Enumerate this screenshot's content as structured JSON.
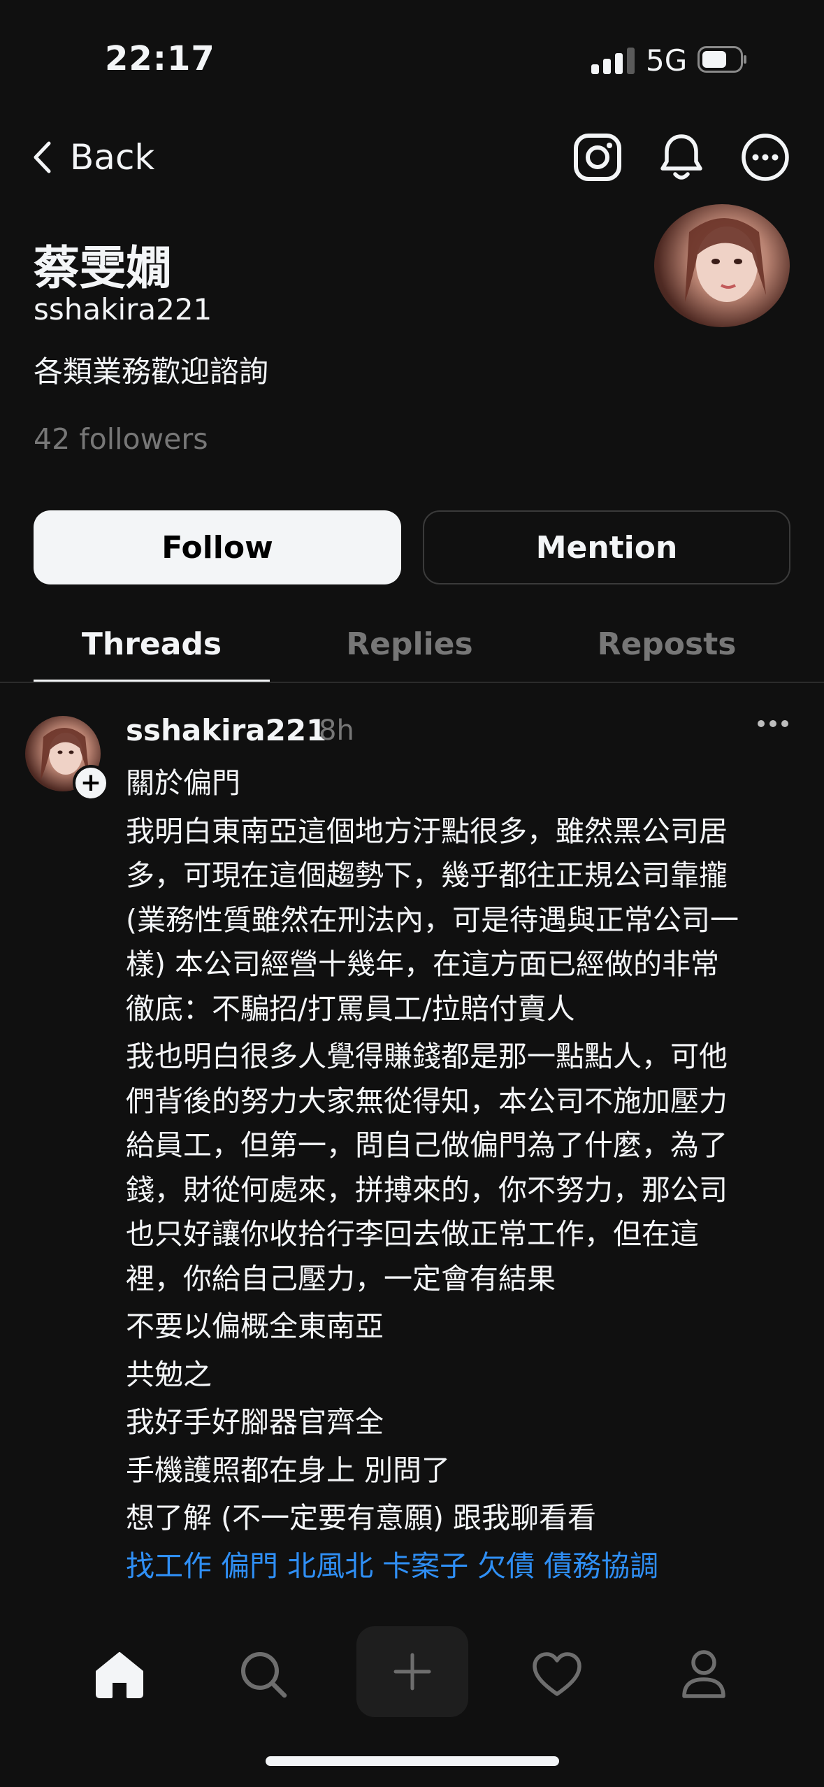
{
  "status_bar": {
    "time": "22:17",
    "network": "5G"
  },
  "header": {
    "back_label": "Back",
    "icons": [
      "instagram-icon",
      "bell-icon",
      "more-icon"
    ]
  },
  "profile": {
    "name": "蔡雯嫺",
    "handle": "sshakira221",
    "bio": "各類業務歡迎諮詢",
    "followers": "42 followers"
  },
  "actions": {
    "follow_label": "Follow",
    "mention_label": "Mention"
  },
  "tabs": [
    {
      "label": "Threads",
      "active": true
    },
    {
      "label": "Replies",
      "active": false
    },
    {
      "label": "Reposts",
      "active": false
    }
  ],
  "post": {
    "username": "sshakira221",
    "time": "8h",
    "lines": [
      "關於偏門",
      "我明白東南亞這個地方汙點很多，雖然黑公司居",
      "多，可現在這個趨勢下，幾乎都往正規公司靠攏",
      "(業務性質雖然在刑法內，可是待遇與正常公司一",
      "樣) 本公司經營十幾年，在這方面已經做的非常",
      "徹底：不騙招/打罵員工/拉賠付賣人",
      "我也明白很多人覺得賺錢都是那一點點人，可他",
      "們背後的努力大家無從得知，本公司不施加壓力",
      "給員工，但第一，問自己做偏門為了什麼，為了",
      "錢，財從何處來，拼搏來的，你不努力，那公司",
      "也只好讓你收拾行李回去做正常工作，但在這",
      "裡，你給自己壓力，一定會有結果",
      "不要以偏概全東南亞",
      "共勉之",
      "我好手好腳器官齊全",
      "手機護照都在身上 別問了",
      "想了解 (不一定要有意願) 跟我聊看看"
    ],
    "tags": "找工作 偏門 北風北 卡案子 欠債 債務協調"
  },
  "tab_bar": {
    "items": [
      "home-icon",
      "search-icon",
      "compose-icon",
      "heart-icon",
      "profile-icon"
    ]
  }
}
